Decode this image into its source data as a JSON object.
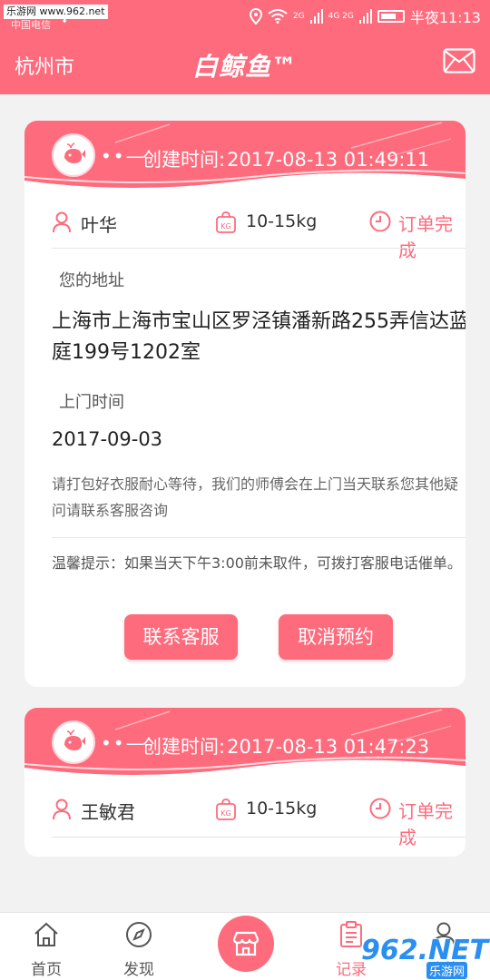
{
  "status_bar": {
    "watermark": "乐游网 www.962.net",
    "carrier": "中国电信",
    "network_tags": [
      "2G",
      "4G 2G"
    ],
    "time": "半夜11:13"
  },
  "header": {
    "city": "杭州市",
    "brand": "白鲸鱼™"
  },
  "orders": [
    {
      "created_label": "创建时间:",
      "created_time": "2017-08-13 01:49:11",
      "customer": "叶华",
      "weight": "10-15kg",
      "status": "订单完成",
      "address_label": "您的地址",
      "address": "上海市上海市宝山区罗泾镇潘新路255弄信达蓝庭199号1202室",
      "visit_label": "上门时间",
      "visit_date": "2017-09-03",
      "notice": "请打包好衣服耐心等待，我们的师傅会在上门当天联系您其他疑问请联系客服咨询",
      "tip": "温馨提示：如果当天下午3:00前未取件，可拨打客服电话催单。",
      "contact_button": "联系客服",
      "cancel_button": "取消预约"
    },
    {
      "created_label": "创建时间:",
      "created_time": "2017-08-13 01:47:23",
      "customer": "王敏君",
      "weight": "10-15kg",
      "status": "订单完成"
    }
  ],
  "tabbar": {
    "home": "首页",
    "discover": "发现",
    "records": "记录",
    "profile": "我的"
  },
  "watermark_bottom": {
    "big": "962.NET",
    "small": "乐游网"
  },
  "colors": {
    "accent": "#fe6b7c",
    "background": "#f2f2f2"
  }
}
